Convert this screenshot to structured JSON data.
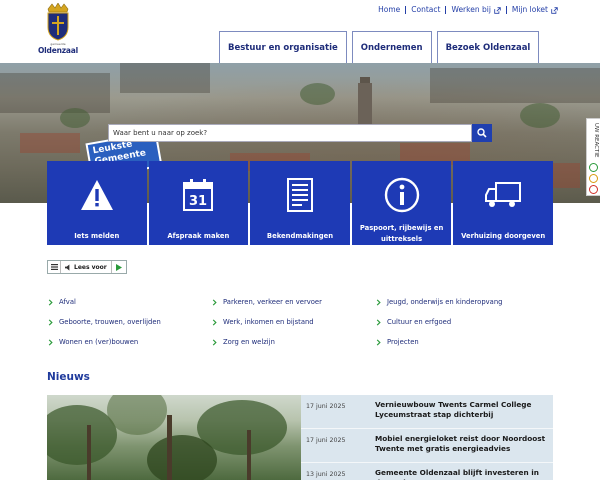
{
  "brand": {
    "name": "Oldenzaal",
    "subtitle": "gemeente"
  },
  "top_links": [
    {
      "label": "Home",
      "external": false
    },
    {
      "label": "Contact",
      "external": false
    },
    {
      "label": "Werken bij",
      "external": true
    },
    {
      "label": "Mijn loket",
      "external": true
    }
  ],
  "main_nav": [
    {
      "label": "Bestuur en organisatie"
    },
    {
      "label": "Ondernemen"
    },
    {
      "label": "Bezoek Oldenzaal"
    }
  ],
  "hero": {
    "badge_line1": "Leukste",
    "badge_line2": "Gemeente"
  },
  "search": {
    "placeholder": "Waar bent u naar op zoek?",
    "button_icon": "search-icon"
  },
  "feedback": {
    "label": "UW REACTIE",
    "faces": [
      "happy-face-icon",
      "neutral-face-icon",
      "sad-face-icon"
    ]
  },
  "tiles": [
    {
      "label": "Iets melden",
      "icon": "warning-icon"
    },
    {
      "label": "Afspraak maken",
      "icon": "calendar-icon",
      "icon_text": "31"
    },
    {
      "label": "Bekendmakingen",
      "icon": "document-icon"
    },
    {
      "label": "Paspoort, rijbewijs en uittreksels",
      "icon": "info-icon"
    },
    {
      "label": "Verhuizing doorgeven",
      "icon": "truck-icon"
    }
  ],
  "readspeaker": {
    "label": "Lees voor"
  },
  "links": {
    "col1": [
      "Afval",
      "Geboorte, trouwen, overlijden",
      "Wonen en (ver)bouwen"
    ],
    "col2": [
      "Parkeren, verkeer en vervoer",
      "Werk, inkomen en bijstand",
      "Zorg en welzijn"
    ],
    "col3": [
      "Jeugd, onderwijs en kinderopvang",
      "Cultuur en erfgoed",
      "Projecten"
    ]
  },
  "news": {
    "title": "Nieuws",
    "items": [
      {
        "date": "17 juni 2025",
        "title": "Vernieuwbouw Twents Carmel College Lyceumstraat stap dichterbij"
      },
      {
        "date": "17 juni 2025",
        "title": "Mobiel energieloket reist door Noordoost Twente met gratis energieadvies"
      },
      {
        "date": "13 juni 2025",
        "title": "Gemeente Oldenzaal blijft investeren in de stad"
      }
    ]
  },
  "colors": {
    "primary": "#1e3ab5",
    "nav_text": "#1f2d7a",
    "news_bg": "#dbe6ee"
  }
}
